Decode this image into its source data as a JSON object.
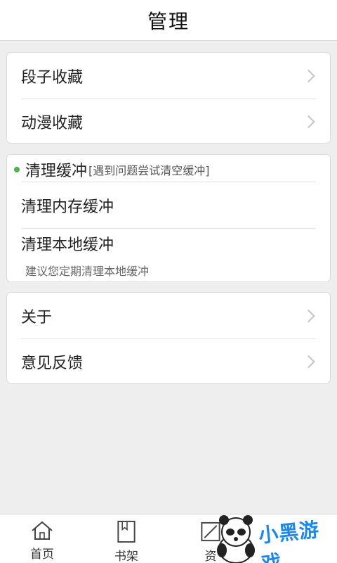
{
  "header": {
    "title": "管理"
  },
  "favorites": {
    "items": [
      {
        "label": "段子收藏"
      },
      {
        "label": "动漫收藏"
      }
    ]
  },
  "cache": {
    "title": "清理缓冲",
    "hint": "[遇到问题尝试清空缓冲]",
    "items": [
      {
        "label": "清理内存缓冲"
      },
      {
        "label": "清理本地缓冲"
      }
    ],
    "note": "建议您定期清理本地缓冲"
  },
  "misc": {
    "items": [
      {
        "label": "关于"
      },
      {
        "label": "意见反馈"
      }
    ]
  },
  "tabbar": {
    "tabs": [
      {
        "label": "首页",
        "icon": "home-icon"
      },
      {
        "label": "书架",
        "icon": "bookshelf-icon"
      },
      {
        "label": "资",
        "icon": "resource-icon"
      }
    ]
  },
  "watermark": {
    "text": "小黑游戏"
  },
  "colors": {
    "accent_dot": "#4caf50"
  }
}
